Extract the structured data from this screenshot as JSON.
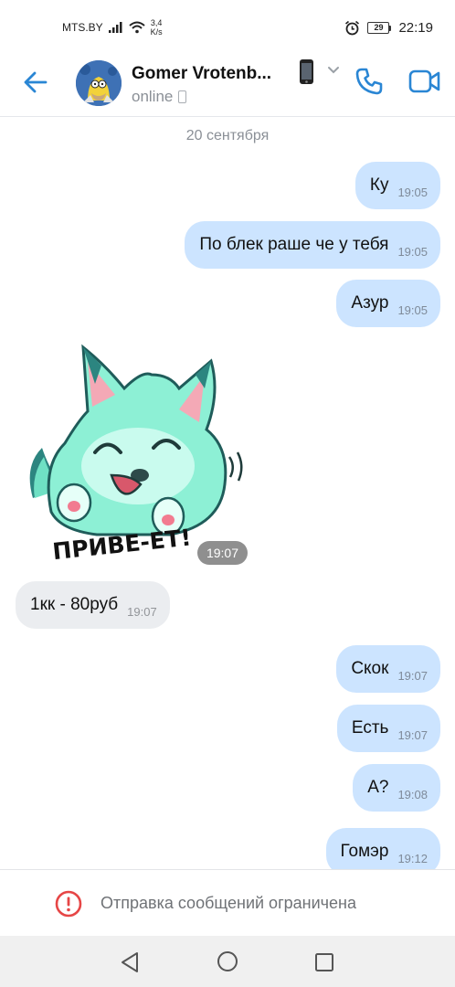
{
  "status_bar": {
    "carrier": "MTS.BY",
    "speed_value": "3,4",
    "speed_unit": "K/s",
    "battery": "29",
    "time": "22:19"
  },
  "header": {
    "contact_name": "Gomer Vrotenb...",
    "contact_status": "online",
    "icons": [
      "back-arrow-icon",
      "phone-emoji-icon",
      "chevron-down-icon",
      "call-icon",
      "video-call-icon"
    ]
  },
  "chat": {
    "date": "20 сентября",
    "messages": [
      {
        "text": "Ку",
        "time": "19:05",
        "dir": "out"
      },
      {
        "text": "По блек раше че у тебя",
        "time": "19:05",
        "dir": "out"
      },
      {
        "text": "Азур",
        "time": "19:05",
        "dir": "out"
      },
      {
        "sticker_text": "ПРИВЕ-ЕТ!",
        "time": "19:07",
        "dir": "in"
      },
      {
        "text": "1кк - 80руб",
        "time": "19:07",
        "dir": "in"
      },
      {
        "text": "Скок",
        "time": "19:07",
        "dir": "out"
      },
      {
        "text": "Есть",
        "time": "19:07",
        "dir": "out"
      },
      {
        "text": "А?",
        "time": "19:08",
        "dir": "out"
      },
      {
        "text": "Гомэр",
        "time": "19:12",
        "dir": "out"
      }
    ]
  },
  "restriction": {
    "text": "Отправка сообщений ограничена"
  },
  "colors": {
    "accent": "#2a86d4",
    "outgoing_bubble": "#cce4ff",
    "incoming_bubble": "#ebedf0",
    "warning": "#e64646"
  }
}
